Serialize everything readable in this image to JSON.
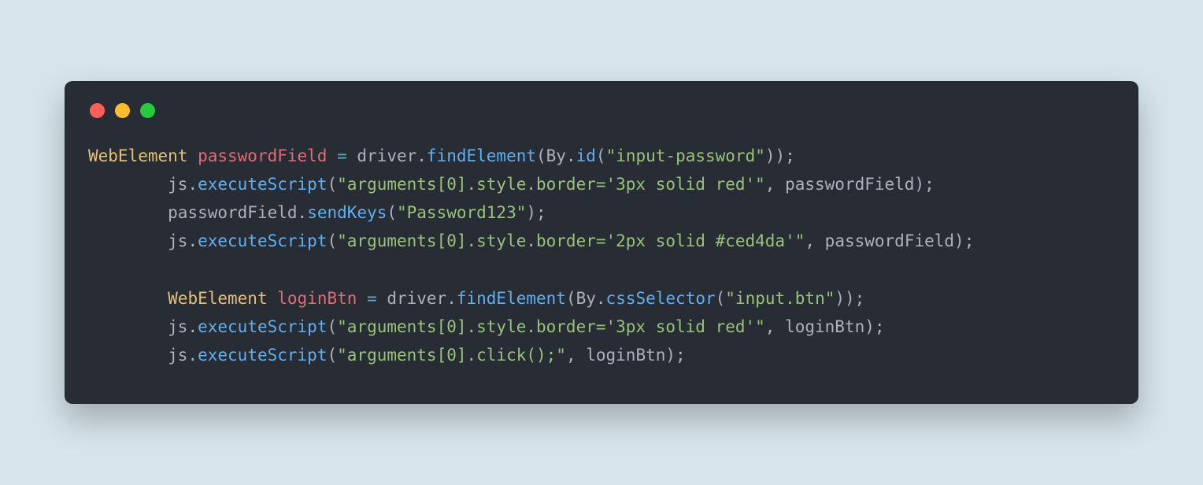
{
  "colors": {
    "background": "#d7e4ec",
    "editor_bg": "#282c34",
    "traffic_red": "#ff5f56",
    "traffic_yellow": "#ffbd2e",
    "traffic_green": "#27c93f",
    "syntax_type": "#e5c07b",
    "syntax_variable": "#e06c75",
    "syntax_operator": "#56b6c2",
    "syntax_default": "#abb2bf",
    "syntax_method": "#61afef",
    "syntax_string": "#98c379"
  },
  "code": {
    "indent": "        ",
    "l1": {
      "type": "WebElement",
      "var": "passwordField",
      "eq": " = ",
      "obj1": "driver",
      "dot1": ".",
      "m1": "findElement",
      "op1": "(",
      "obj2": "By",
      "dot2": ".",
      "m2": "id",
      "op2": "(",
      "str": "\"input-password\"",
      "cl": "));"
    },
    "l2": {
      "obj": "js",
      "dot": ".",
      "m": "executeScript",
      "op": "(",
      "str": "\"arguments[0].style.border='3px solid red'\"",
      "comma": ", ",
      "arg": "passwordField",
      "cl": ");"
    },
    "l3": {
      "obj": "passwordField",
      "dot": ".",
      "m": "sendKeys",
      "op": "(",
      "str": "\"Password123\"",
      "cl": ");"
    },
    "l4": {
      "obj": "js",
      "dot": ".",
      "m": "executeScript",
      "op": "(",
      "str": "\"arguments[0].style.border='2px solid #ced4da'\"",
      "comma": ", ",
      "arg": "passwordField",
      "cl": ");"
    },
    "l5": "",
    "l6": {
      "type": "WebElement",
      "var": "loginBtn",
      "eq": " = ",
      "obj1": "driver",
      "dot1": ".",
      "m1": "findElement",
      "op1": "(",
      "obj2": "By",
      "dot2": ".",
      "m2": "cssSelector",
      "op2": "(",
      "str": "\"input.btn\"",
      "cl": "));"
    },
    "l7": {
      "obj": "js",
      "dot": ".",
      "m": "executeScript",
      "op": "(",
      "str": "\"arguments[0].style.border='3px solid red'\"",
      "comma": ", ",
      "arg": "loginBtn",
      "cl": ");"
    },
    "l8": {
      "obj": "js",
      "dot": ".",
      "m": "executeScript",
      "op": "(",
      "str": "\"arguments[0].click();\"",
      "comma": ", ",
      "arg": "loginBtn",
      "cl": ");"
    }
  }
}
